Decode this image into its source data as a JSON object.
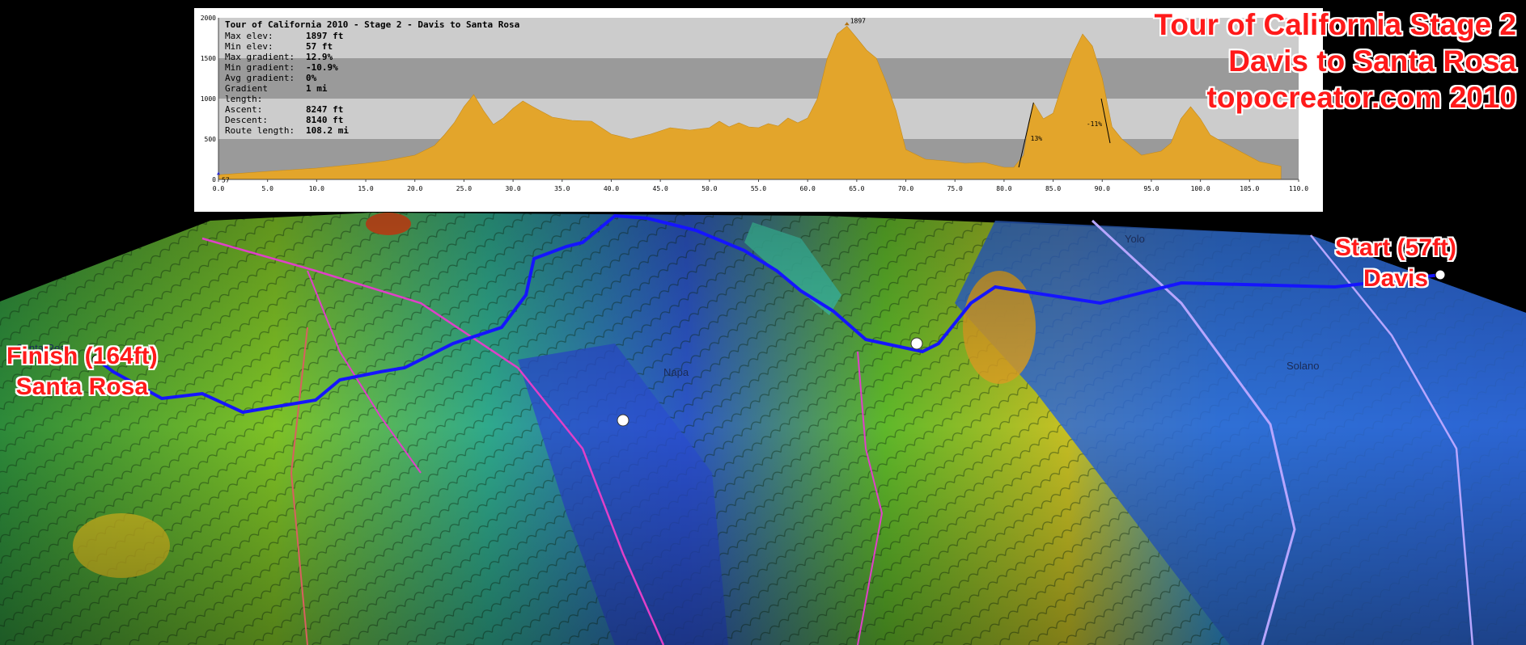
{
  "headline": {
    "line1": "Tour of California Stage 2",
    "line2": "Davis to Santa Rosa",
    "line3": "topocreator.com 2010"
  },
  "start_label": {
    "line1": "Start (57ft)",
    "line2": "Davis"
  },
  "finish_label": {
    "line1": "Finish (164ft)",
    "line2": "Santa Rosa"
  },
  "profile": {
    "title": "Tour of California 2010 - Stage 2 - Davis to Santa Rosa",
    "stats": [
      {
        "key": "Max elev:",
        "value": "1897 ft"
      },
      {
        "key": "Min elev:",
        "value": "57 ft"
      },
      {
        "key": "Max gradient:",
        "value": "12.9%"
      },
      {
        "key": "Min gradient:",
        "value": "-10.9%"
      },
      {
        "key": "Avg gradient:",
        "value": "0%"
      },
      {
        "key": "Gradient length:",
        "value": "1 mi"
      },
      {
        "key": "Ascent:",
        "value": "8247 ft"
      },
      {
        "key": "Descent:",
        "value": "8140 ft"
      },
      {
        "key": "Route length:",
        "value": "108.2 mi"
      }
    ],
    "peak_label": "1897",
    "start_label": "57",
    "grade_labels": [
      "13%",
      "-11%"
    ],
    "colors": {
      "fill": "#e3a52b",
      "band_light": "#cccccc",
      "band_dark": "#9a9a9a"
    }
  },
  "map_labels": [
    "Yolo",
    "Solano",
    "Santa Rosa",
    "Napa"
  ],
  "chart_data": {
    "type": "area",
    "title": "Tour of California 2010 - Stage 2 - Davis to Santa Rosa",
    "xlabel": "",
    "ylabel": "",
    "xlim": [
      0,
      110
    ],
    "ylim": [
      0,
      2000
    ],
    "x_ticks": [
      "0.0",
      "5.0",
      "10.0",
      "15.0",
      "20.0",
      "25.0",
      "30.0",
      "35.0",
      "40.0",
      "45.0",
      "50.0",
      "55.0",
      "60.0",
      "65.0",
      "70.0",
      "75.0",
      "80.0",
      "85.0",
      "90.0",
      "95.0",
      "100.0",
      "105.0",
      "110.0"
    ],
    "y_ticks": [
      "0",
      "500",
      "1000",
      "1500",
      "2000"
    ],
    "series": [
      {
        "x": [
          0,
          5,
          10,
          15,
          17,
          20,
          21,
          22,
          23,
          24,
          25,
          26,
          27,
          28,
          29,
          30,
          31,
          32,
          34,
          36,
          38,
          40,
          42,
          44,
          46,
          48,
          50,
          51,
          52,
          53,
          54,
          55,
          56,
          57,
          58,
          59,
          60,
          61,
          62,
          63,
          64,
          65,
          66,
          67,
          68,
          69,
          70,
          72,
          74,
          76,
          78,
          80,
          81,
          82,
          82.5,
          83,
          84,
          85,
          86,
          87,
          88,
          89,
          90,
          91,
          92,
          94,
          96,
          97,
          98,
          99,
          100,
          101,
          102,
          104,
          106,
          108.2
        ],
        "y": [
          57,
          100,
          140,
          200,
          230,
          300,
          360,
          420,
          550,
          700,
          900,
          1050,
          850,
          680,
          760,
          880,
          970,
          900,
          770,
          730,
          720,
          560,
          500,
          560,
          640,
          610,
          640,
          720,
          650,
          700,
          650,
          640,
          690,
          660,
          760,
          700,
          760,
          1000,
          1500,
          1800,
          1897,
          1750,
          1600,
          1500,
          1200,
          850,
          370,
          250,
          230,
          200,
          210,
          150,
          150,
          300,
          700,
          950,
          750,
          820,
          1200,
          1550,
          1800,
          1650,
          1250,
          650,
          500,
          300,
          350,
          450,
          750,
          900,
          750,
          550,
          480,
          350,
          220,
          164
        ]
      }
    ],
    "annotations": [
      "1897",
      "57",
      "13%",
      "-11%"
    ]
  }
}
